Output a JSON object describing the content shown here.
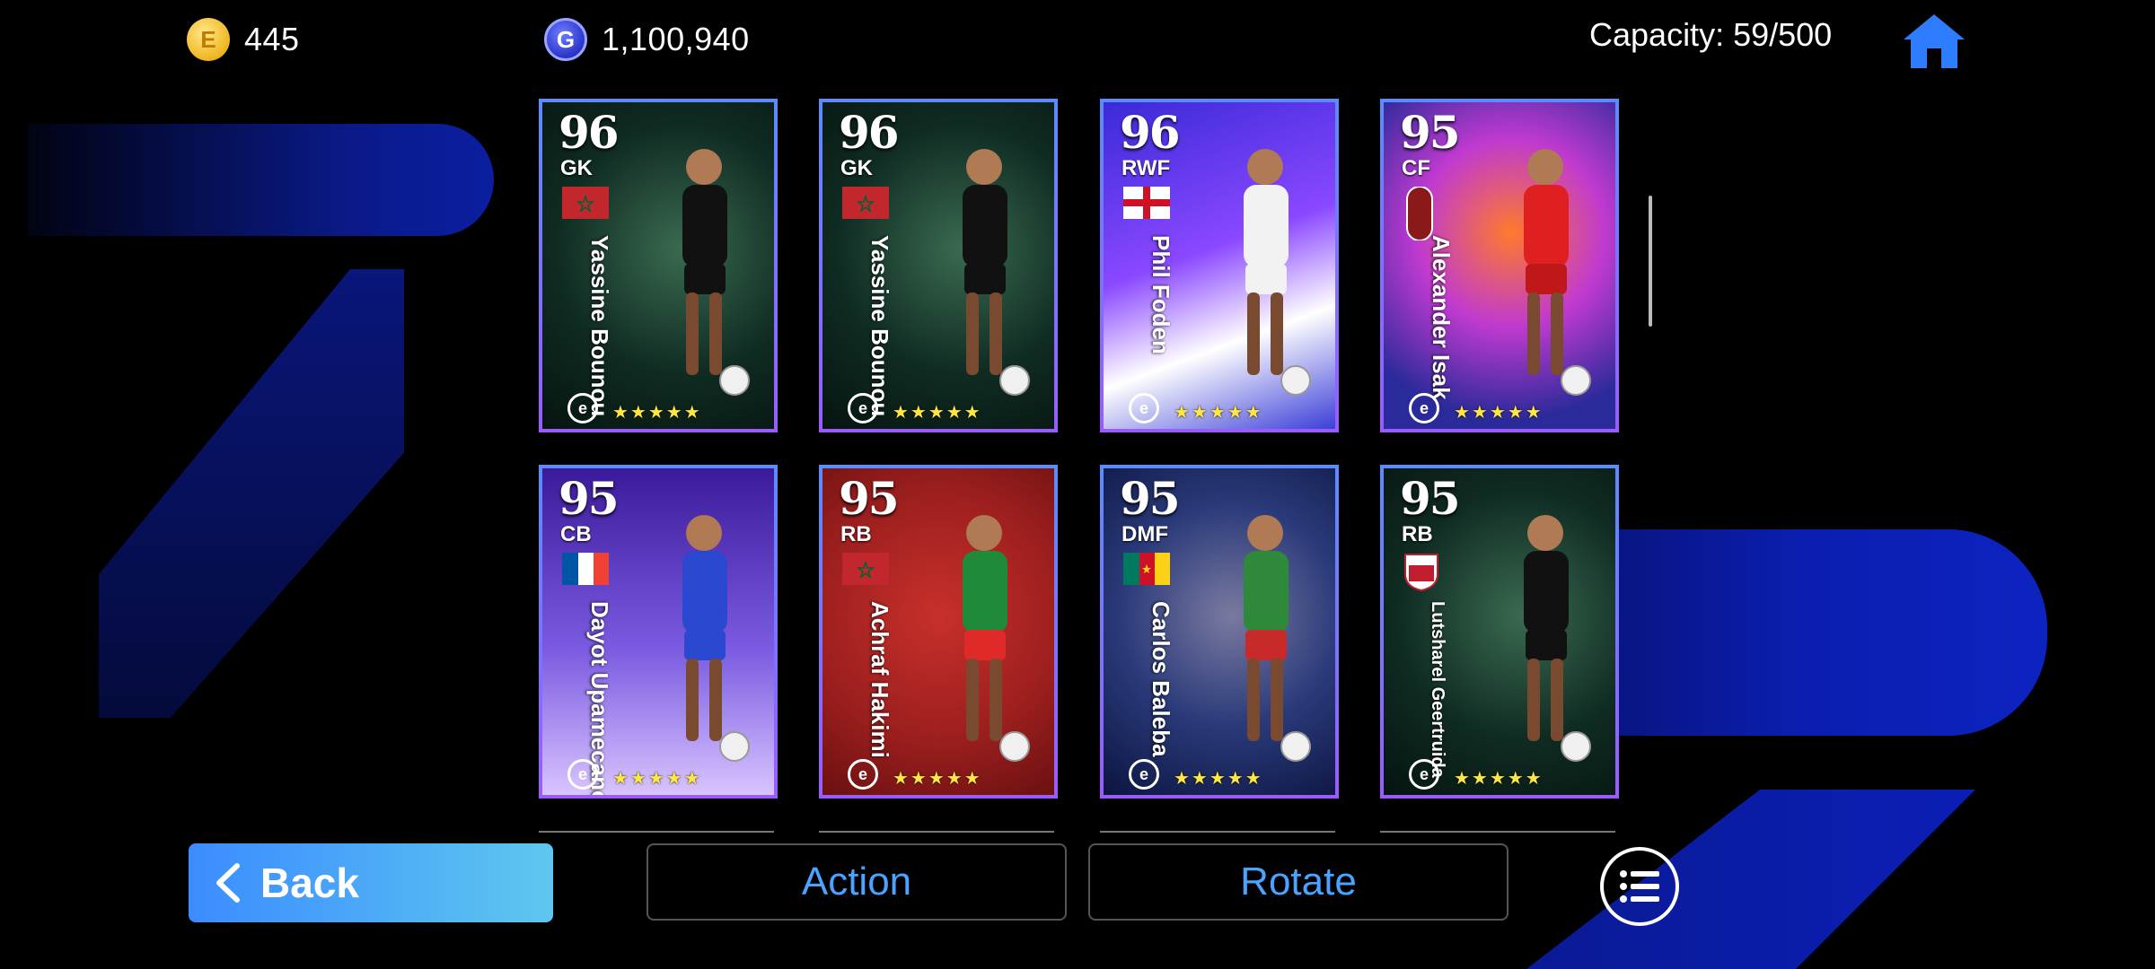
{
  "topbar": {
    "coins": "445",
    "coin_icon_letter": "E",
    "gp": "1,100,940",
    "gp_icon_letter": "G",
    "capacity": "Capacity: 59/500"
  },
  "cards": [
    {
      "rating": "96",
      "position": "GK",
      "name": "Yassine Bounou",
      "flag": "morocco",
      "stars": "★★★★★",
      "theme": "green"
    },
    {
      "rating": "96",
      "position": "GK",
      "name": "Yassine Bounou",
      "flag": "morocco",
      "stars": "★★★★★",
      "theme": "green"
    },
    {
      "rating": "96",
      "position": "RWF",
      "name": "Phil Foden",
      "flag": "england",
      "stars": "★★★★★",
      "theme": "purple"
    },
    {
      "rating": "95",
      "position": "CF",
      "name": "Alexander Isak",
      "flag": "club",
      "stars": "★★★★★",
      "theme": "fire"
    },
    {
      "rating": "95",
      "position": "CB",
      "name": "Dayot Upamecano",
      "flag": "france",
      "stars": "★★★★★",
      "theme": "violet"
    },
    {
      "rating": "95",
      "position": "RB",
      "name": "Achraf Hakimi",
      "flag": "morocco",
      "stars": "★★★★★",
      "theme": "red"
    },
    {
      "rating": "95",
      "position": "DMF",
      "name": "Carlos Baleba",
      "flag": "cameroon",
      "stars": "★★★★★",
      "theme": "tunnel"
    },
    {
      "rating": "95",
      "position": "RB",
      "name": "Lutsharel Geertruida",
      "flag": "club2",
      "stars": "★★★★★",
      "theme": "green"
    }
  ],
  "buttons": {
    "back": "Back",
    "action": "Action",
    "rotate": "Rotate"
  },
  "colors": {
    "accent": "#4aa3ff",
    "back_gradient_start": "#3b8cff",
    "back_gradient_end": "#5ec7ee",
    "star": "#ffe642"
  },
  "icons": [
    "e-coin-icon",
    "gp-coin-icon",
    "home-icon",
    "chevron-left-icon",
    "list-menu-icon",
    "efootball-logo-icon"
  ]
}
